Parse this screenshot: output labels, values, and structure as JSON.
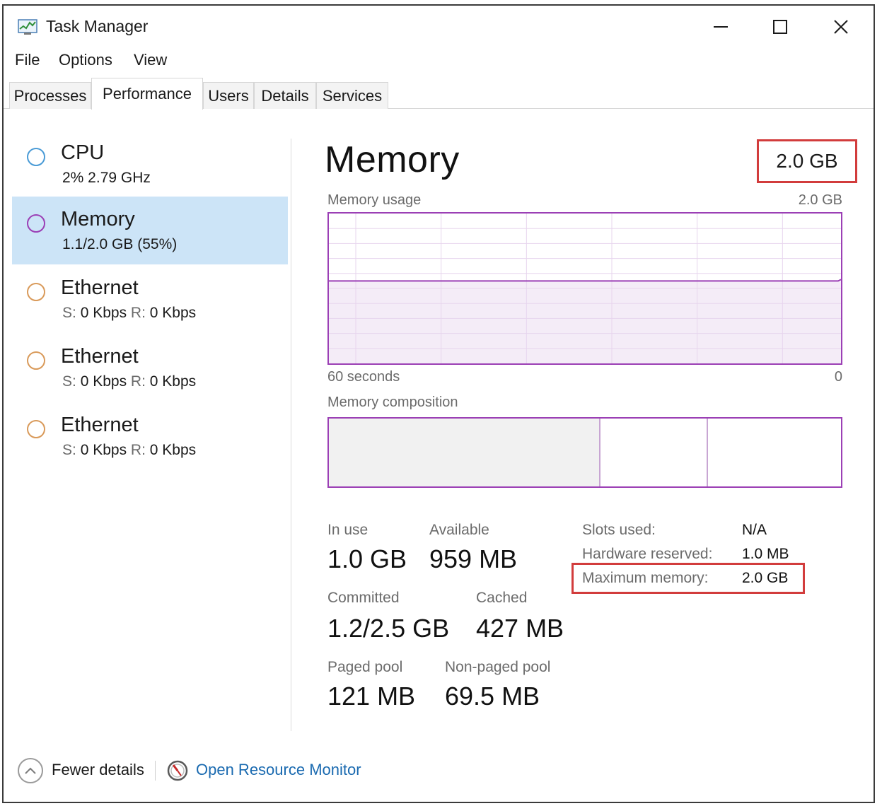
{
  "window": {
    "title": "Task Manager",
    "app_icon": "task-manager-icon"
  },
  "menu": {
    "items": [
      "File",
      "Options",
      "View"
    ]
  },
  "tabs": {
    "items": [
      "Processes",
      "Performance",
      "Users",
      "Details",
      "Services"
    ],
    "active": "Performance"
  },
  "sidebar": {
    "items": [
      {
        "title": "CPU",
        "sub_main": "2%  2.79 GHz",
        "sub_parts": null,
        "circle_color": "#4a9bd6",
        "selected": false
      },
      {
        "title": "Memory",
        "sub_main": "1.1/2.0 GB (55%)",
        "sub_parts": null,
        "circle_color": "#9b3fb5",
        "selected": true
      },
      {
        "title": "Ethernet",
        "sub_parts": {
          "s_label": "S:",
          "s_value": "0 Kbps",
          "r_label": "R:",
          "r_value": "0 Kbps"
        },
        "circle_color": "#d99a5a",
        "selected": false
      },
      {
        "title": "Ethernet",
        "sub_parts": {
          "s_label": "S:",
          "s_value": "0 Kbps",
          "r_label": "R:",
          "r_value": "0 Kbps"
        },
        "circle_color": "#d99a5a",
        "selected": false
      },
      {
        "title": "Ethernet",
        "sub_parts": {
          "s_label": "S:",
          "s_value": "0 Kbps",
          "r_label": "R:",
          "r_value": "0 Kbps"
        },
        "circle_color": "#d99a5a",
        "selected": false
      }
    ]
  },
  "main": {
    "heading": "Memory",
    "total": "2.0 GB",
    "usage_graph": {
      "label": "Memory usage",
      "max_label": "2.0 GB",
      "time_label": "60 seconds",
      "zero_label": "0",
      "usage_fraction": 0.55,
      "line_color": "#9b3fb5",
      "fill_color": "#f4ecf7",
      "grid_color": "#e7d5ee"
    },
    "composition": {
      "label": "Memory composition",
      "in_use_fraction": 0.53,
      "modified_fraction": 0.21
    },
    "stats": {
      "in_use_label": "In use",
      "in_use_value": "1.0 GB",
      "available_label": "Available",
      "available_value": "959 MB",
      "committed_label": "Committed",
      "committed_value": "1.2/2.5 GB",
      "cached_label": "Cached",
      "cached_value": "427 MB",
      "paged_label": "Paged pool",
      "paged_value": "121 MB",
      "nonpaged_label": "Non-paged pool",
      "nonpaged_value": "69.5 MB"
    },
    "details": {
      "slots_label": "Slots used:",
      "slots_value": "N/A",
      "hw_label": "Hardware reserved:",
      "hw_value": "1.0 MB",
      "max_label": "Maximum memory:",
      "max_value": "2.0 GB"
    }
  },
  "footer": {
    "fewer_details": "Fewer details",
    "resource_monitor": "Open Resource Monitor"
  },
  "colors": {
    "highlight_box": "#d23c3c",
    "selected_bg": "#cce4f7",
    "link": "#1a6ab0"
  }
}
